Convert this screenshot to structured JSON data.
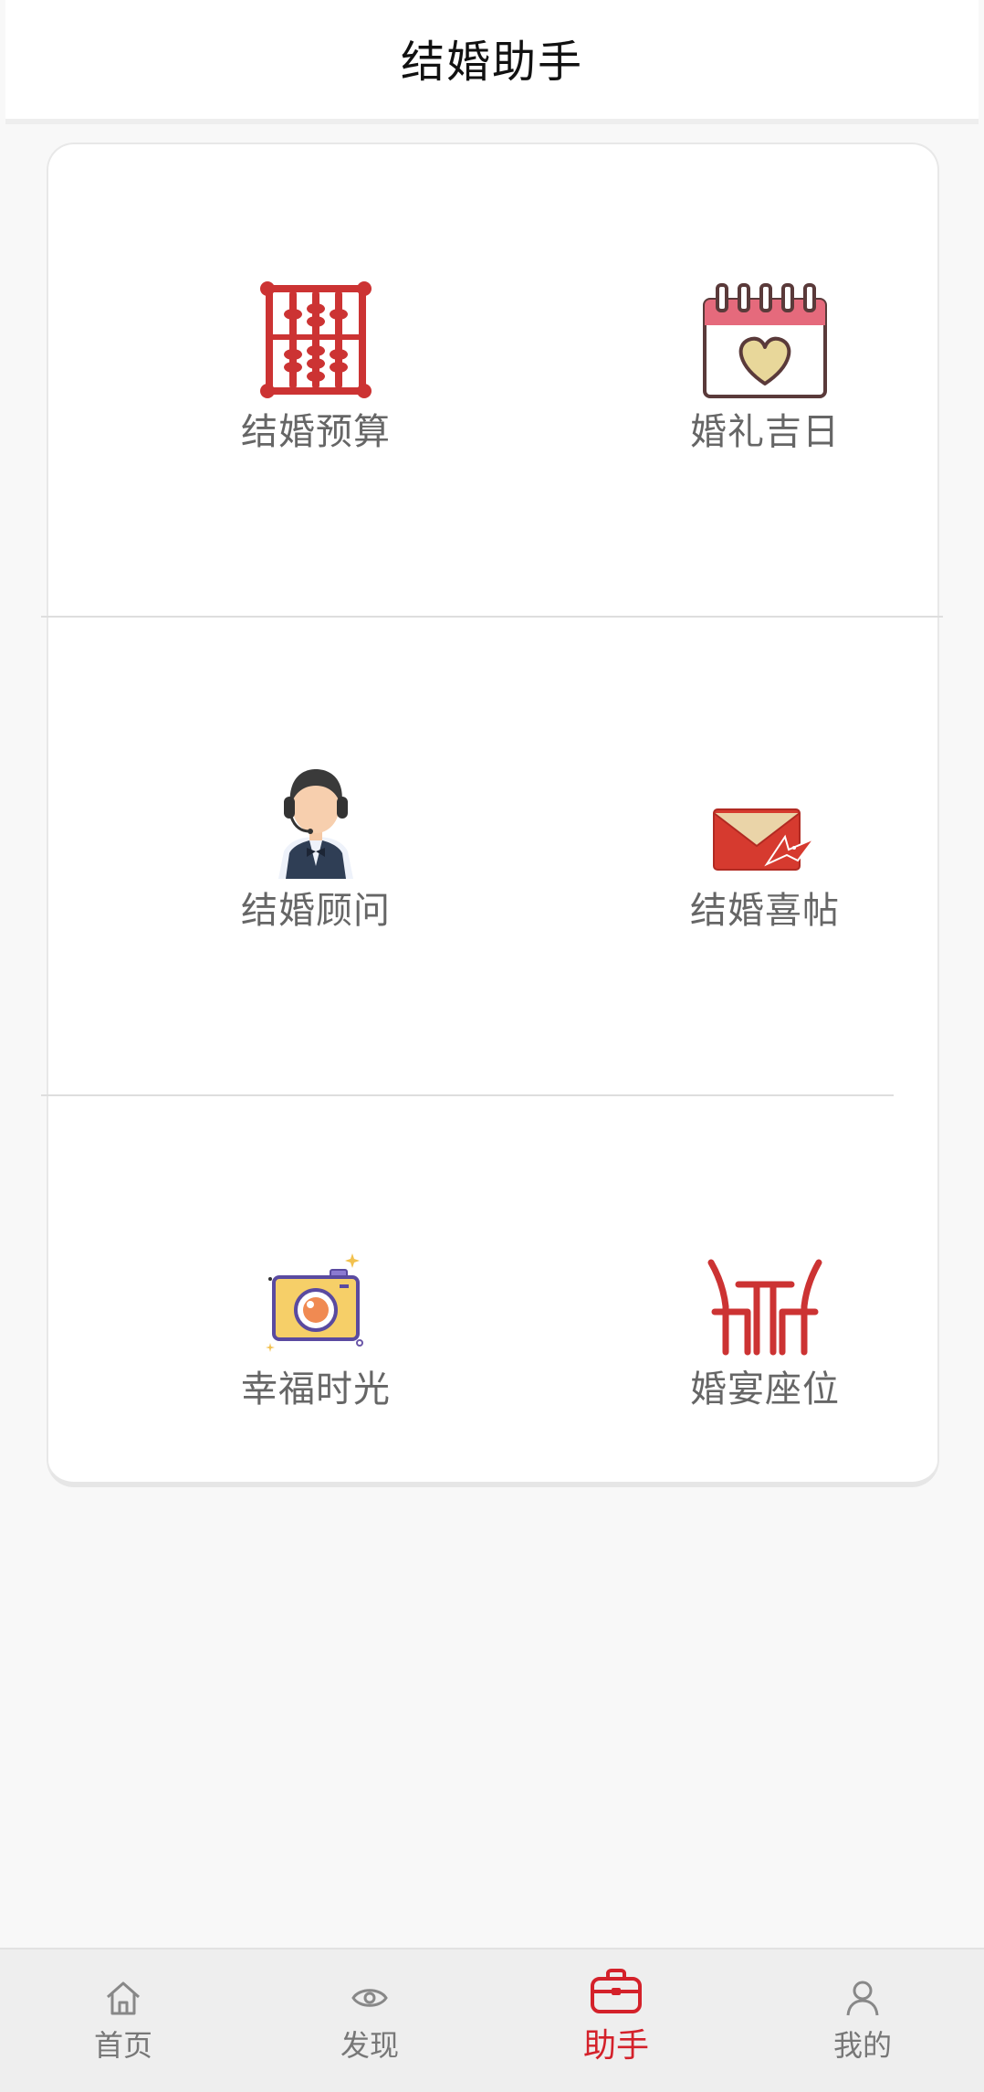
{
  "header": {
    "title": "结婚助手"
  },
  "tools": [
    {
      "label": "结婚预算",
      "icon": "abacus-icon"
    },
    {
      "label": "婚礼吉日",
      "icon": "calendar-heart-icon"
    },
    {
      "label": "结婚顾问",
      "icon": "consultant-icon"
    },
    {
      "label": "结婚喜帖",
      "icon": "envelope-icon"
    },
    {
      "label": "幸福时光",
      "icon": "camera-icon"
    },
    {
      "label": "婚宴座位",
      "icon": "table-chairs-icon"
    }
  ],
  "tabbar": {
    "items": [
      {
        "label": "首页",
        "icon": "home-icon",
        "active": false
      },
      {
        "label": "发现",
        "icon": "eye-icon",
        "active": false
      },
      {
        "label": "助手",
        "icon": "briefcase-icon",
        "active": true
      },
      {
        "label": "我的",
        "icon": "person-icon",
        "active": false
      }
    ]
  },
  "colors": {
    "accent": "#d4212a",
    "icon_red": "#cc3333",
    "label_gray": "#666666"
  }
}
